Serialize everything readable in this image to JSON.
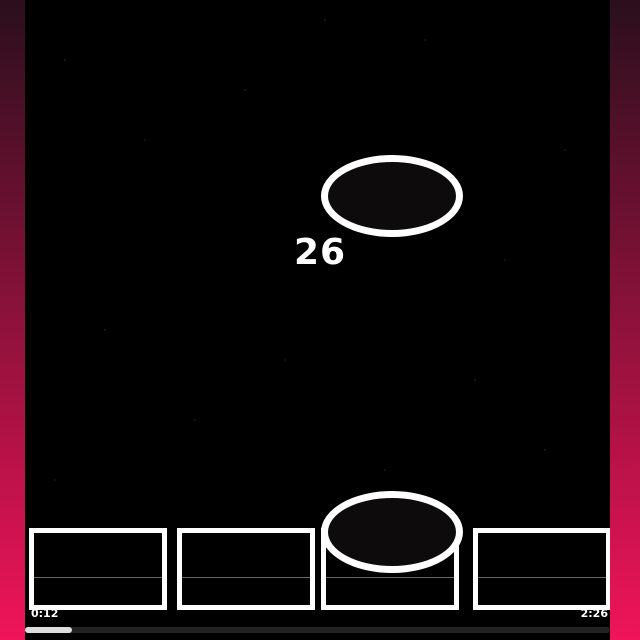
{
  "game": {
    "score": "26",
    "lanes": [
      {
        "name": "lane-1"
      },
      {
        "name": "lane-2"
      },
      {
        "name": "lane-3"
      },
      {
        "name": "lane-4"
      }
    ]
  },
  "playback": {
    "current_time": "0:12",
    "total_time": "2:26",
    "progress_fraction": 0.08
  },
  "colors": {
    "background_top": "#2a0f1c",
    "background_bottom": "#f0145a",
    "stage": "#000000",
    "outline": "#ffffff"
  }
}
